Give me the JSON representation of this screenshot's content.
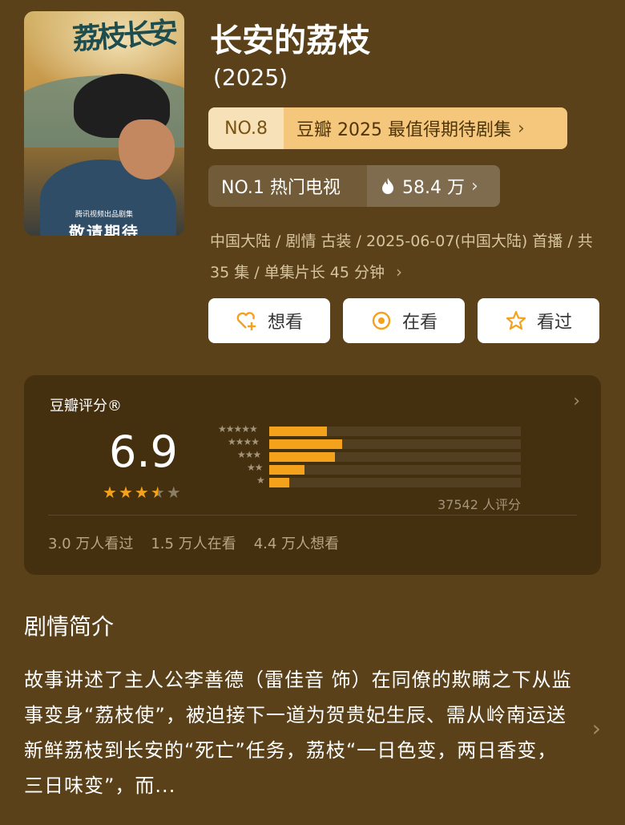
{
  "header": {
    "title": "长安的荔枝",
    "year": "(2025)",
    "poster": {
      "title_art": "荔枝长安",
      "studio": "腾讯视频出品剧集",
      "tagline": "敬请期待"
    }
  },
  "rankings": {
    "expected": {
      "rank": "NO.8",
      "label": "豆瓣 2025 最值得期待剧集"
    },
    "hot": {
      "rank_label": "NO.1 热门电视",
      "heat": "58.4 万"
    }
  },
  "meta": {
    "line": "中国大陆 / 剧情 古装 / 2025-06-07(中国大陆) 首播 / 共 35 集 / 单集片长 45 分钟"
  },
  "actions": {
    "want": "想看",
    "watching": "在看",
    "watched": "看过"
  },
  "rating": {
    "heading": "豆瓣评分®",
    "score": "6.9",
    "stars_value": 3.5,
    "count_text": "37542 人评分",
    "distribution": [
      {
        "stars": 5,
        "fraction": 0.23
      },
      {
        "stars": 4,
        "fraction": 0.29
      },
      {
        "stars": 3,
        "fraction": 0.26
      },
      {
        "stars": 2,
        "fraction": 0.14
      },
      {
        "stars": 1,
        "fraction": 0.08
      }
    ],
    "stats": {
      "watched": "3.0 万人看过",
      "watching": "1.5 万人在看",
      "want": "4.4 万人想看"
    }
  },
  "synopsis": {
    "title": "剧情简介",
    "text": "故事讲述了主人公李善德（雷佳音 饰）在同僚的欺瞒之下从监事变身“荔枝使”，被迫接下一道为贺贵妃生辰、需从岭南运送新鲜荔枝到长安的“死亡”任务，荔枝“一日色变，两日香变，三日味变”，而..."
  },
  "colors": {
    "background": "#5a4119",
    "card": "#442f0f",
    "accent": "#f4a11b",
    "rank_badge": "#f4c77d"
  }
}
